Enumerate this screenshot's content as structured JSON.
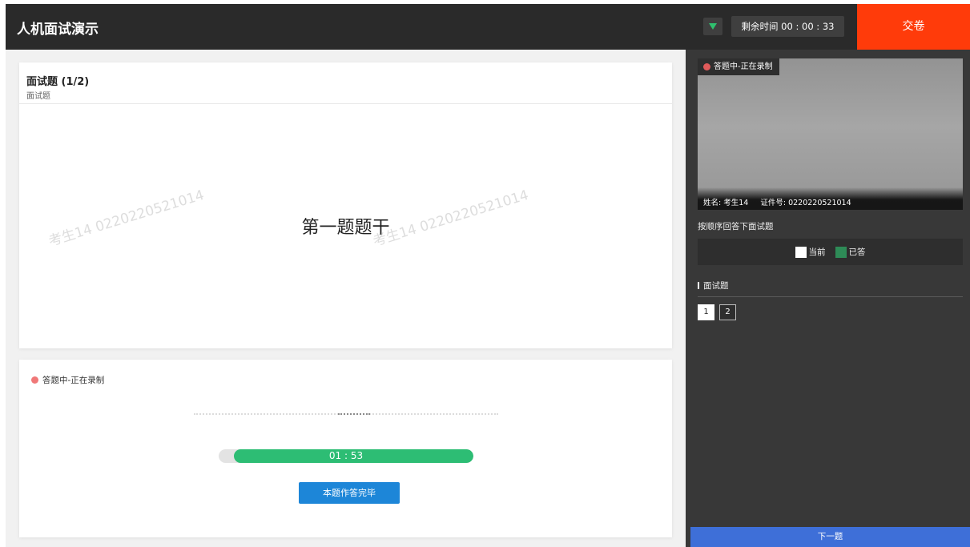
{
  "header": {
    "title": "人机面试演示",
    "timer": "剩余时间 00 : 00 : 33",
    "submit_label": "交卷"
  },
  "question": {
    "title": "面试题 (1/2)",
    "subtitle": "面试题",
    "stem": "第一题题干",
    "watermark": "考生14 0220220521014"
  },
  "answer": {
    "status": "答题中-正在录制",
    "countdown": "01 : 53",
    "progress_fraction": 0.94,
    "done_label": "本题作答完毕"
  },
  "sidebar": {
    "video_status": "答题中-正在录制",
    "name_text": "姓名: 考生14",
    "id_text": "证件号: 0220220521014",
    "instruction": "按顺序回答下面试题",
    "legend": [
      {
        "label": "当前",
        "color": "#ffffff"
      },
      {
        "label": "已答",
        "color": "#2e8b57"
      }
    ],
    "section_title": "面试题",
    "question_numbers": [
      "1",
      "2"
    ],
    "next_label": "下一题"
  },
  "colors": {
    "accent_submit": "#ff3b0a",
    "progress": "#2dbd74",
    "primary_button": "#1d86d8",
    "next_button": "#3e6fd8"
  }
}
